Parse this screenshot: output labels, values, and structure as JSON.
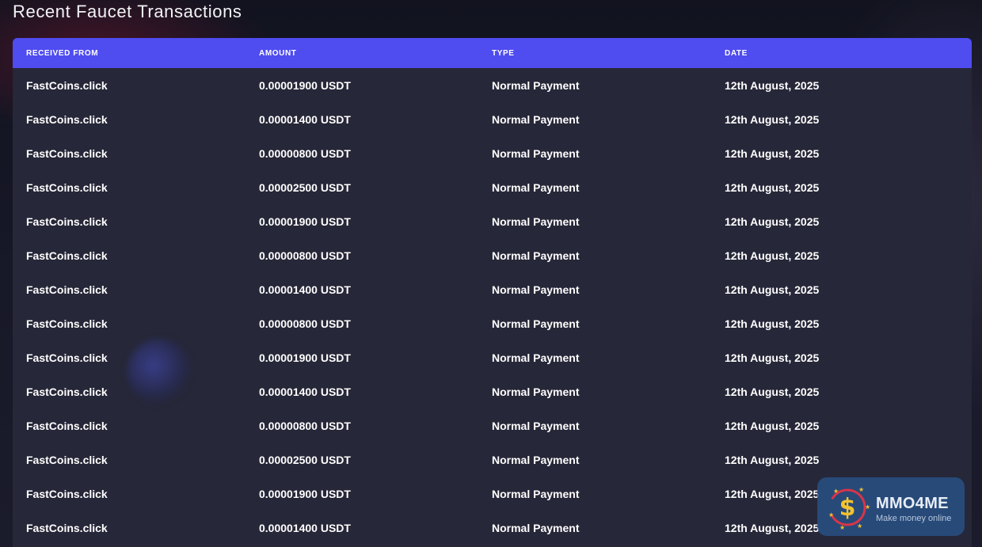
{
  "page": {
    "title": "Recent Faucet Transactions"
  },
  "table": {
    "headers": [
      "RECEIVED FROM",
      "AMOUNT",
      "TYPE",
      "DATE"
    ],
    "rows": [
      [
        "FastCoins.click",
        "0.00001900 USDT",
        "Normal Payment",
        "12th August, 2025"
      ],
      [
        "FastCoins.click",
        "0.00001400 USDT",
        "Normal Payment",
        "12th August, 2025"
      ],
      [
        "FastCoins.click",
        "0.00000800 USDT",
        "Normal Payment",
        "12th August, 2025"
      ],
      [
        "FastCoins.click",
        "0.00002500 USDT",
        "Normal Payment",
        "12th August, 2025"
      ],
      [
        "FastCoins.click",
        "0.00001900 USDT",
        "Normal Payment",
        "12th August, 2025"
      ],
      [
        "FastCoins.click",
        "0.00000800 USDT",
        "Normal Payment",
        "12th August, 2025"
      ],
      [
        "FastCoins.click",
        "0.00001400 USDT",
        "Normal Payment",
        "12th August, 2025"
      ],
      [
        "FastCoins.click",
        "0.00000800 USDT",
        "Normal Payment",
        "12th August, 2025"
      ],
      [
        "FastCoins.click",
        "0.00001900 USDT",
        "Normal Payment",
        "12th August, 2025"
      ],
      [
        "FastCoins.click",
        "0.00001400 USDT",
        "Normal Payment",
        "12th August, 2025"
      ],
      [
        "FastCoins.click",
        "0.00000800 USDT",
        "Normal Payment",
        "12th August, 2025"
      ],
      [
        "FastCoins.click",
        "0.00002500 USDT",
        "Normal Payment",
        "12th August, 2025"
      ],
      [
        "FastCoins.click",
        "0.00001900 USDT",
        "Normal Payment",
        "12th August, 2025"
      ],
      [
        "FastCoins.click",
        "0.00001400 USDT",
        "Normal Payment",
        "12th August, 2025"
      ]
    ]
  },
  "watermark": {
    "name": "MMO4ME",
    "tagline": "Make money online",
    "icon": "dollar-coin-icon"
  },
  "colors": {
    "header_bg": "#4f4cf0",
    "table_bg": "#262738",
    "page_bg": "#171828"
  }
}
